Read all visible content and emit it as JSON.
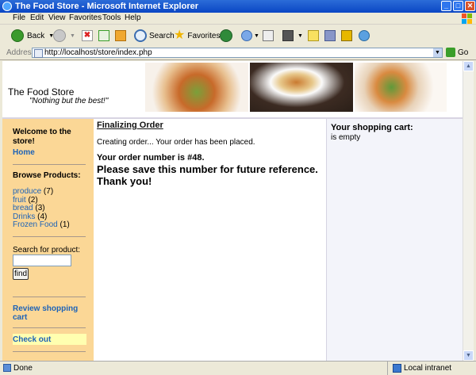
{
  "window": {
    "title": "The Food Store - Microsoft Internet Explorer"
  },
  "menu": [
    "File",
    "Edit",
    "View",
    "Favorites",
    "Tools",
    "Help"
  ],
  "toolbar": {
    "back": "Back",
    "search": "Search",
    "favorites": "Favorites"
  },
  "address": {
    "label": "Address",
    "url": "http://localhost/store/index.php",
    "go": "Go"
  },
  "site": {
    "name": "The Food Store",
    "slogan": "\"Nothing but the best!\""
  },
  "sidebar": {
    "welcome": "Welcome to the store!",
    "home": "Home",
    "browse_heading": "Browse Products:",
    "categories": [
      {
        "name": "produce",
        "count": "(7)"
      },
      {
        "name": "fruit",
        "count": "(2)"
      },
      {
        "name": "bread",
        "count": "(3)"
      },
      {
        "name": "Drinks",
        "count": "(4)"
      },
      {
        "name": "Frozen Food",
        "count": "(1)"
      }
    ],
    "search_label": "Search for product:",
    "search_value": "",
    "find_button": "find",
    "review_cart": "Review shopping cart",
    "checkout": "Check out"
  },
  "main": {
    "heading": "Finalizing Order",
    "status": "Creating order... Your order has been placed.",
    "order_number": "Your order number is #48.",
    "save_notice": "Please save this number for future reference.",
    "thanks": "Thank you!"
  },
  "cart": {
    "heading": "Your shopping cart:",
    "status": "is empty"
  },
  "statusbar": {
    "status": "Done",
    "zone": "Local intranet"
  },
  "colors": {
    "sidebar": "#fbd796",
    "link": "#1e63b7",
    "checkout_highlight": "#ffffb0",
    "titlebar": "#0a46c4"
  }
}
